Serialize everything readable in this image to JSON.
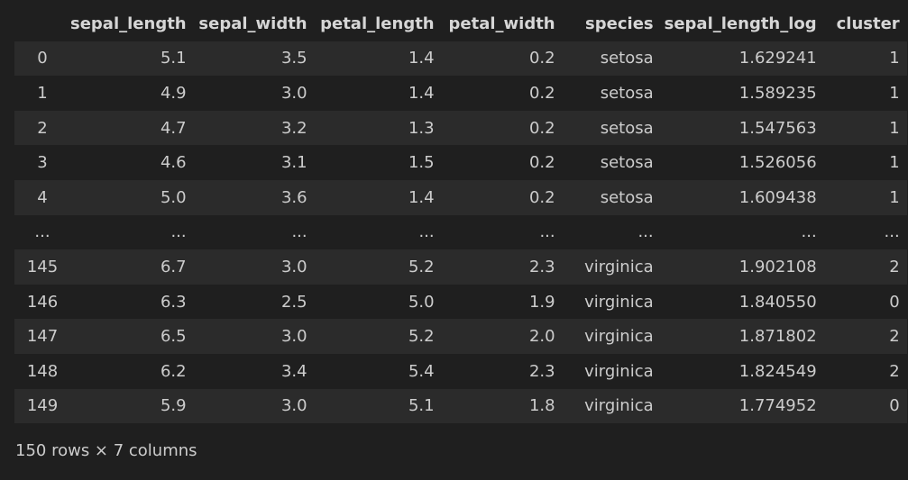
{
  "table": {
    "columns": [
      "",
      "sepal_length",
      "sepal_width",
      "petal_length",
      "petal_width",
      "species",
      "sepal_length_log",
      "cluster"
    ],
    "rows": [
      {
        "index": "0",
        "cells": [
          "5.1",
          "3.5",
          "1.4",
          "0.2",
          "setosa",
          "1.629241",
          "1"
        ]
      },
      {
        "index": "1",
        "cells": [
          "4.9",
          "3.0",
          "1.4",
          "0.2",
          "setosa",
          "1.589235",
          "1"
        ]
      },
      {
        "index": "2",
        "cells": [
          "4.7",
          "3.2",
          "1.3",
          "0.2",
          "setosa",
          "1.547563",
          "1"
        ]
      },
      {
        "index": "3",
        "cells": [
          "4.6",
          "3.1",
          "1.5",
          "0.2",
          "setosa",
          "1.526056",
          "1"
        ]
      },
      {
        "index": "4",
        "cells": [
          "5.0",
          "3.6",
          "1.4",
          "0.2",
          "setosa",
          "1.609438",
          "1"
        ]
      },
      {
        "index": "...",
        "cells": [
          "...",
          "...",
          "...",
          "...",
          "...",
          "...",
          "..."
        ]
      },
      {
        "index": "145",
        "cells": [
          "6.7",
          "3.0",
          "5.2",
          "2.3",
          "virginica",
          "1.902108",
          "2"
        ]
      },
      {
        "index": "146",
        "cells": [
          "6.3",
          "2.5",
          "5.0",
          "1.9",
          "virginica",
          "1.840550",
          "0"
        ]
      },
      {
        "index": "147",
        "cells": [
          "6.5",
          "3.0",
          "5.2",
          "2.0",
          "virginica",
          "1.871802",
          "2"
        ]
      },
      {
        "index": "148",
        "cells": [
          "6.2",
          "3.4",
          "5.4",
          "2.3",
          "virginica",
          "1.824549",
          "2"
        ]
      },
      {
        "index": "149",
        "cells": [
          "5.9",
          "3.0",
          "5.1",
          "1.8",
          "virginica",
          "1.774952",
          "0"
        ]
      }
    ]
  },
  "footer": {
    "summary": "150 rows × 7 columns"
  }
}
